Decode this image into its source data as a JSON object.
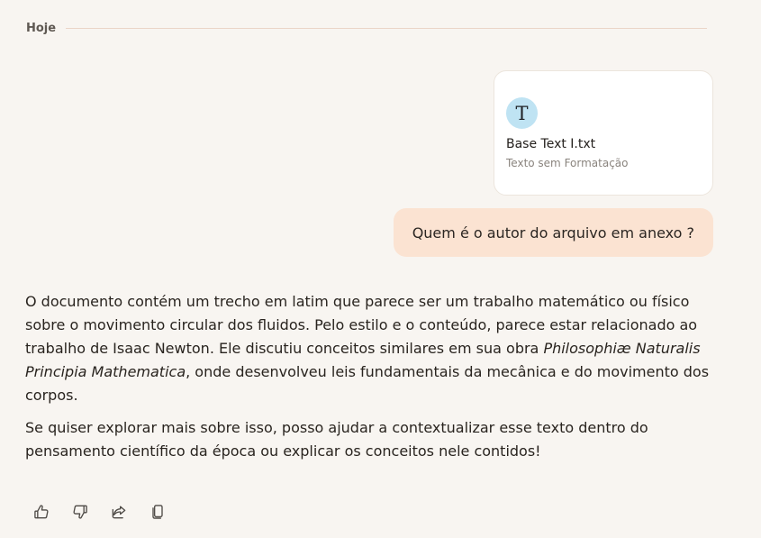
{
  "date_divider": {
    "label": "Hoje"
  },
  "attachment": {
    "icon_letter": "T",
    "file_name": "Base Text I.txt",
    "file_type": "Texto sem Formatação"
  },
  "user_message": {
    "text": "Quem é o autor do arquivo em anexo ?"
  },
  "assistant_message": {
    "paragraph_1": {
      "intro": "O documento contém um trecho em latim que parece ser um trabalho matemático ou físico sobre o movimento circular dos fluidos. Pelo estilo e o conteúdo, parece estar relacionado ao trabalho de Isaac Newton. Ele discutiu conceitos similares em sua obra ",
      "emphasis": "Philosophiæ Naturalis Principia Mathematica",
      "outro": ", onde desenvolveu leis fundamentais da mecânica e do movimento dos corpos."
    },
    "paragraph_2": "Se quiser explorar mais sobre isso, posso ajudar a contextualizar esse texto dentro do pensamento científico da época ou explicar os conceitos nele contidos!"
  },
  "actions": [
    {
      "icon": "thumbs-up-icon"
    },
    {
      "icon": "thumbs-down-icon"
    },
    {
      "icon": "share-icon"
    },
    {
      "icon": "copy-icon"
    }
  ],
  "colors": {
    "background": "#f8f5f1",
    "user_bubble": "#fbe3d2",
    "file_icon": "#bfe3f3",
    "divider": "#ead5c7"
  }
}
